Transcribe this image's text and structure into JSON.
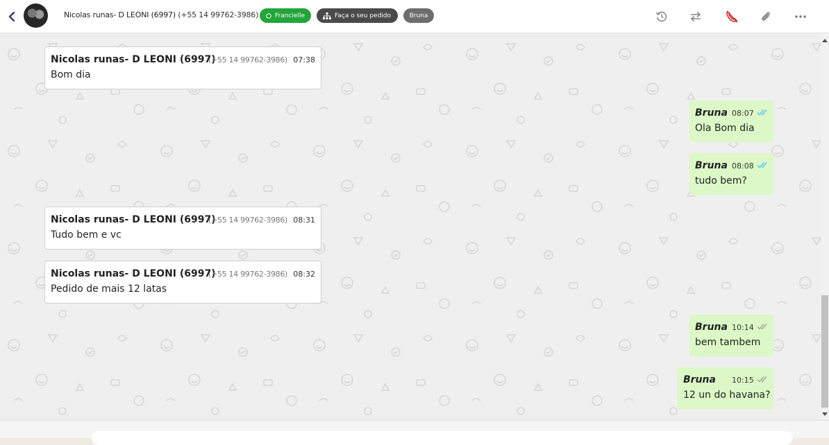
{
  "header": {
    "contact_name": "Nicolas runas- D LEONI (6997)",
    "contact_phone": "(+55 14 99762-3986)",
    "tags": [
      {
        "label": "Francielle",
        "color": "#22a539",
        "icon": "whatsapp-icon"
      },
      {
        "label": "Faça o seu pedido",
        "color": "#4a4a4a",
        "icon": "sitemap-icon"
      },
      {
        "label": "Bruna",
        "color": "#6d6d6d"
      }
    ],
    "tools": [
      "history-icon",
      "transfer-icon",
      "hangup-icon",
      "attach-icon",
      "more-icon"
    ]
  },
  "messages": [
    {
      "direction": "in",
      "name": "Nicolas runas- D LEONI (6997)",
      "phone": "(+55 14 99762-3986)",
      "time": "07:38",
      "text": "Bom dia"
    },
    {
      "direction": "out",
      "author": "Bruna",
      "time": "08:07",
      "text": "Ola Bom dia",
      "status": "read",
      "check_color": "#4fc3f7"
    },
    {
      "direction": "out",
      "author": "Bruna",
      "time": "08:08",
      "text": "tudo bem?",
      "status": "read",
      "check_color": "#4fc3f7"
    },
    {
      "direction": "in",
      "name": "Nicolas runas- D LEONI (6997)",
      "phone": "(+55 14 99762-3986)",
      "time": "08:31",
      "text": "Tudo bem e vc"
    },
    {
      "direction": "in",
      "name": "Nicolas runas- D LEONI (6997)",
      "phone": "(+55 14 99762-3986)",
      "time": "08:32",
      "text": "Pedido de mais 12 latas"
    },
    {
      "direction": "out",
      "author": "Bruna",
      "time": "10:14",
      "text": "bem tambem",
      "status": "delivered",
      "check_color": "#9e9e9e"
    },
    {
      "direction": "out",
      "author": "Bruna",
      "time": "10:15",
      "text": "12 un do havana?",
      "status": "delivered",
      "check_color": "#9e9e9e"
    }
  ],
  "colors": {
    "incoming_bubble": "#ffffff",
    "outgoing_bubble": "#dcf8c6",
    "chat_background": "#efefef"
  }
}
